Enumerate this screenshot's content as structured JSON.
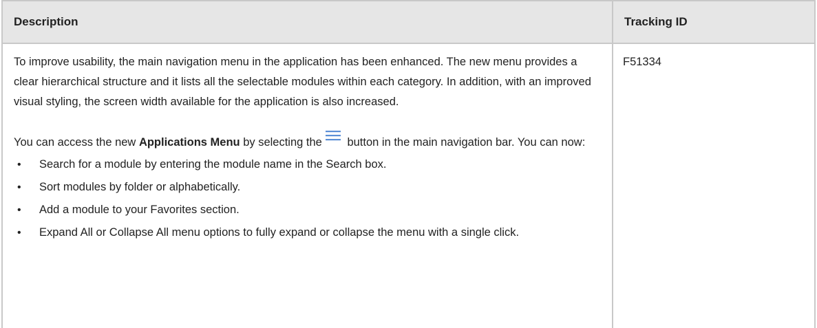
{
  "table": {
    "headers": {
      "description": "Description",
      "tracking_id": "Tracking ID"
    },
    "row": {
      "tracking_id": "F51334",
      "paragraph1": "To improve usability, the main navigation menu in the application has been enhanced. The new menu provides a clear hierarchical structure and it lists all the selectable modules within each category. In addition, with an improved visual styling, the screen width available for the application is also increased.",
      "paragraph2": {
        "prefix": "You can access the new ",
        "bold": "Applications Menu",
        "middle": " by selecting the",
        "suffix": " button in the main navigation bar. You can now:",
        "icon": "hamburger-menu-icon",
        "icon_color": "#5b8fd6"
      },
      "features": [
        "Search for a module by entering the module name in the Search box.",
        "Sort modules by folder or alphabetically.",
        "Add a module to your Favorites section.",
        "Expand All or Collapse All menu options to fully expand or collapse the menu with a single click."
      ]
    }
  }
}
